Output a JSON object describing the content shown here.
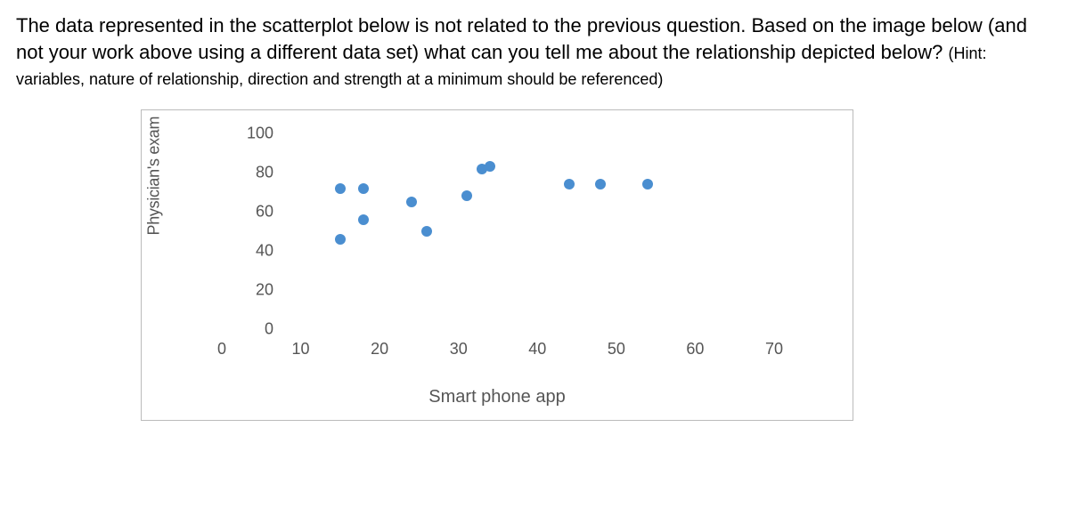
{
  "question": {
    "main": "The data represented in the scatterplot below is not related to the previous question.   Based on the image below (and not your work above using a different data set) what can you tell me about the relationship depicted below? ",
    "hint": "(Hint: variables, nature of relationship, direction and strength at a minimum should be referenced)"
  },
  "chart_data": {
    "type": "scatter",
    "title": "",
    "xlabel": "Smart phone app",
    "ylabel": "Physician's exam",
    "xlim": [
      0,
      70
    ],
    "ylim": [
      0,
      100
    ],
    "xticks": [
      0,
      10,
      20,
      30,
      40,
      50,
      60,
      70
    ],
    "yticks": [
      0,
      20,
      40,
      60,
      80,
      100
    ],
    "points": [
      {
        "x": 15,
        "y": 46
      },
      {
        "x": 15,
        "y": 72
      },
      {
        "x": 18,
        "y": 56
      },
      {
        "x": 18,
        "y": 72
      },
      {
        "x": 24,
        "y": 65
      },
      {
        "x": 26,
        "y": 50
      },
      {
        "x": 31,
        "y": 68
      },
      {
        "x": 33,
        "y": 82
      },
      {
        "x": 34,
        "y": 83
      },
      {
        "x": 44,
        "y": 74
      },
      {
        "x": 48,
        "y": 74
      },
      {
        "x": 54,
        "y": 74
      }
    ]
  }
}
